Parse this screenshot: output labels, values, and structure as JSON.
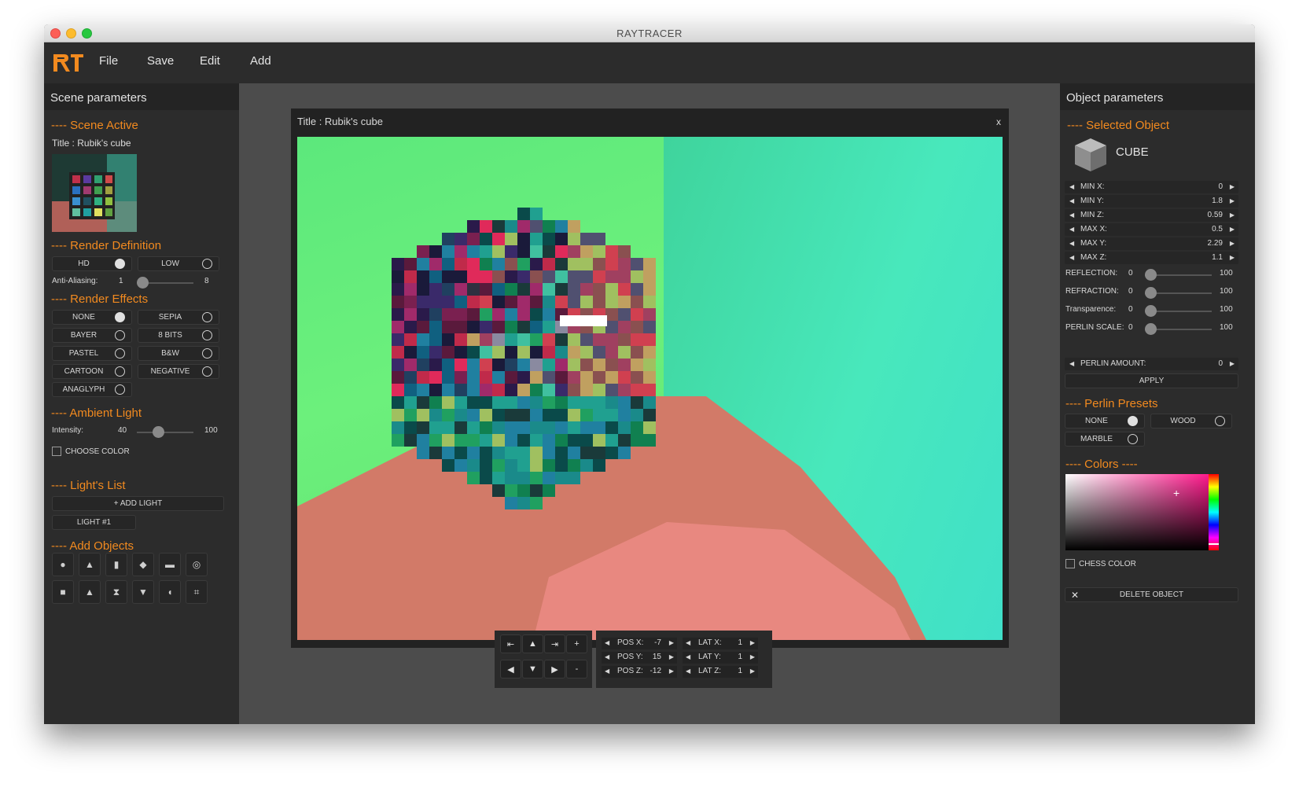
{
  "window": {
    "title": "RAYTRACER"
  },
  "menu": {
    "items": [
      "File",
      "Save",
      "Edit",
      "Add"
    ]
  },
  "colors": {
    "accent": "#f28a1f",
    "panel": "#2c2c2c",
    "workspace": "#4c4c4c"
  },
  "left_panel": {
    "header": "Scene parameters",
    "scene_active": {
      "heading": "---- Scene Active",
      "title": "Title : Rubik's cube"
    },
    "render_definition": {
      "heading": "---- Render Definition",
      "options": [
        {
          "label": "HD",
          "selected": true
        },
        {
          "label": "LOW",
          "selected": false
        }
      ],
      "aa": {
        "label": "Anti-Aliasing:",
        "min": "1",
        "max": "8",
        "value": 1
      }
    },
    "render_effects": {
      "heading": "---- Render Effects",
      "options": [
        {
          "label": "NONE",
          "selected": true
        },
        {
          "label": "SEPIA",
          "selected": false
        },
        {
          "label": "BAYER",
          "selected": false
        },
        {
          "label": "8 BITS",
          "selected": false
        },
        {
          "label": "PASTEL",
          "selected": false
        },
        {
          "label": "B&W",
          "selected": false
        },
        {
          "label": "CARTOON",
          "selected": false
        },
        {
          "label": "NEGATIVE",
          "selected": false
        },
        {
          "label": "ANAGLYPH",
          "selected": false
        }
      ]
    },
    "ambient_light": {
      "heading": "---- Ambient Light",
      "intensity_label": "Intensity:",
      "value": "40",
      "max": "100",
      "choose_color": "CHOOSE COLOR"
    },
    "lights": {
      "heading": "---- Light's List",
      "add": "+ ADD LIGHT",
      "items": [
        "LIGHT #1"
      ]
    },
    "add_objects": {
      "heading": "---- Add Objects",
      "icons": [
        "sphere-icon",
        "cone-icon",
        "cylinder-icon",
        "plane-icon",
        "disk-icon",
        "torus-icon",
        "cube-icon",
        "pyramid-icon",
        "hourglass-icon",
        "paraboloid-icon",
        "hemisphere-icon",
        "composite-icon"
      ]
    }
  },
  "render_window": {
    "title": "Title : Rubik's cube",
    "close": "x"
  },
  "camera": {
    "nav_buttons": [
      {
        "name": "rotate-left-button",
        "glyph": "⇤"
      },
      {
        "name": "move-up-button",
        "glyph": "▲"
      },
      {
        "name": "rotate-right-button",
        "glyph": "⇥"
      },
      {
        "name": "zoom-in-button",
        "glyph": "+"
      },
      {
        "name": "move-left-button",
        "glyph": "◀"
      },
      {
        "name": "move-down-button",
        "glyph": "▼"
      },
      {
        "name": "move-right-button",
        "glyph": "▶"
      },
      {
        "name": "zoom-out-button",
        "glyph": "-"
      }
    ],
    "pos": [
      {
        "label": "POS X:",
        "value": "-7"
      },
      {
        "label": "POS Y:",
        "value": "15"
      },
      {
        "label": "POS Z:",
        "value": "-12"
      }
    ],
    "lat": [
      {
        "label": "LAT X:",
        "value": "1"
      },
      {
        "label": "LAT Y:",
        "value": "1"
      },
      {
        "label": "LAT Z:",
        "value": "1"
      }
    ]
  },
  "right_panel": {
    "header": "Object parameters",
    "selected": {
      "heading": "---- Selected Object",
      "type": "CUBE"
    },
    "params": [
      {
        "label": "MIN X:",
        "value": "0"
      },
      {
        "label": "MIN Y:",
        "value": "1.8"
      },
      {
        "label": "MIN Z:",
        "value": "0.59"
      },
      {
        "label": "MAX X:",
        "value": "0.5"
      },
      {
        "label": "MAX Y:",
        "value": "2.29"
      },
      {
        "label": "MAX Z:",
        "value": "1.1"
      }
    ],
    "sliders": [
      {
        "label": "REFLECTION:",
        "min": "0",
        "max": "100",
        "value": 0
      },
      {
        "label": "REFRACTION:",
        "min": "0",
        "max": "100",
        "value": 0
      },
      {
        "label": "Transparence:",
        "min": "0",
        "max": "100",
        "value": 0
      },
      {
        "label": "PERLIN SCALE:",
        "min": "0",
        "max": "100",
        "value": 0
      }
    ],
    "perlin_amount": {
      "label": "PERLIN AMOUNT:",
      "value": "0"
    },
    "apply": "APPLY",
    "perlin_presets": {
      "heading": "---- Perlin Presets",
      "options": [
        {
          "label": "NONE",
          "selected": true
        },
        {
          "label": "WOOD",
          "selected": false
        },
        {
          "label": "MARBLE",
          "selected": false
        }
      ]
    },
    "colors": {
      "heading": "---- Colors ----",
      "hue": "#ff1a8c"
    },
    "chess_color": "CHESS COLOR",
    "delete": "DELETE OBJECT"
  }
}
